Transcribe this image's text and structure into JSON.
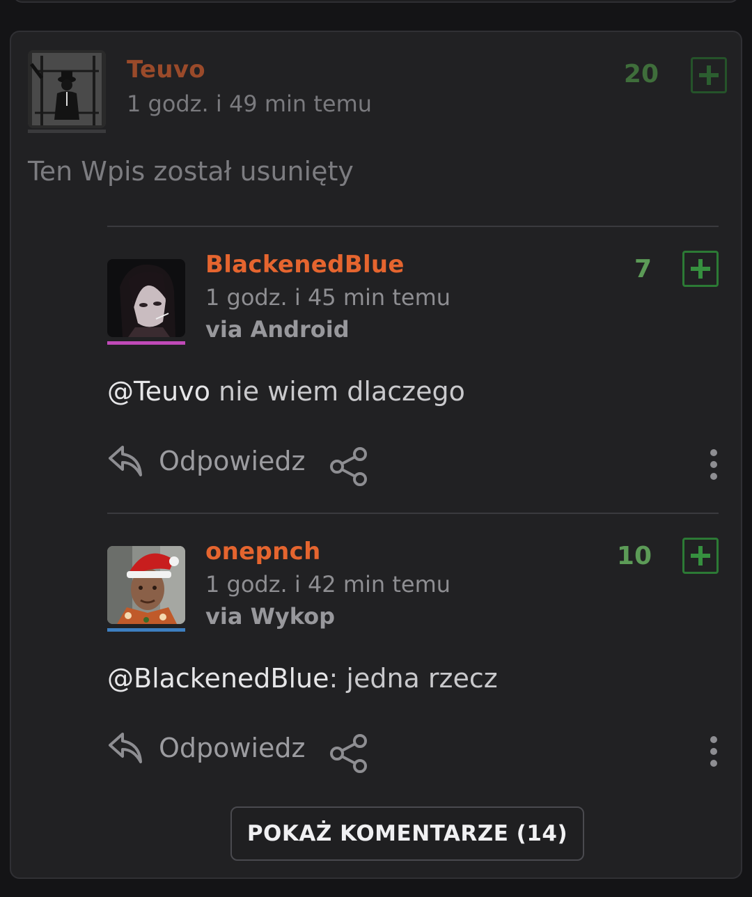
{
  "colors": {
    "background": "#141416",
    "card": "#212123",
    "username_orange": "#e5652f",
    "username_deleted": "#9a4a2a",
    "vote_green": "#5c9b57",
    "plus_border": "#2c7a35"
  },
  "post": {
    "author": "Teuvo",
    "time": "1 godz. i 49 min temu",
    "score": "20",
    "body": "Ten Wpis został usunięty"
  },
  "comments": [
    {
      "author": "BlackenedBlue",
      "time": "1 godz. i 45 min temu",
      "via": "via Android",
      "score": "7",
      "mention": "@Teuvo",
      "text": " nie wiem dlaczego",
      "reply_label": "Odpowiedz",
      "avatar_bar_color": "#c04ab8"
    },
    {
      "author": "onepnch",
      "time": "1 godz. i 42 min temu",
      "via": "via Wykop",
      "score": "10",
      "mention": "@BlackenedBlue",
      "text": ": jedna rzecz",
      "reply_label": "Odpowiedz",
      "avatar_bar_color": "#3d7fc0"
    }
  ],
  "show_comments_label": "POKAŻ KOMENTARZE (14)",
  "icons": {
    "upvote": "plus-square-icon",
    "reply": "reply-arrow-icon",
    "share": "share-icon",
    "more": "vertical-dots-icon"
  }
}
